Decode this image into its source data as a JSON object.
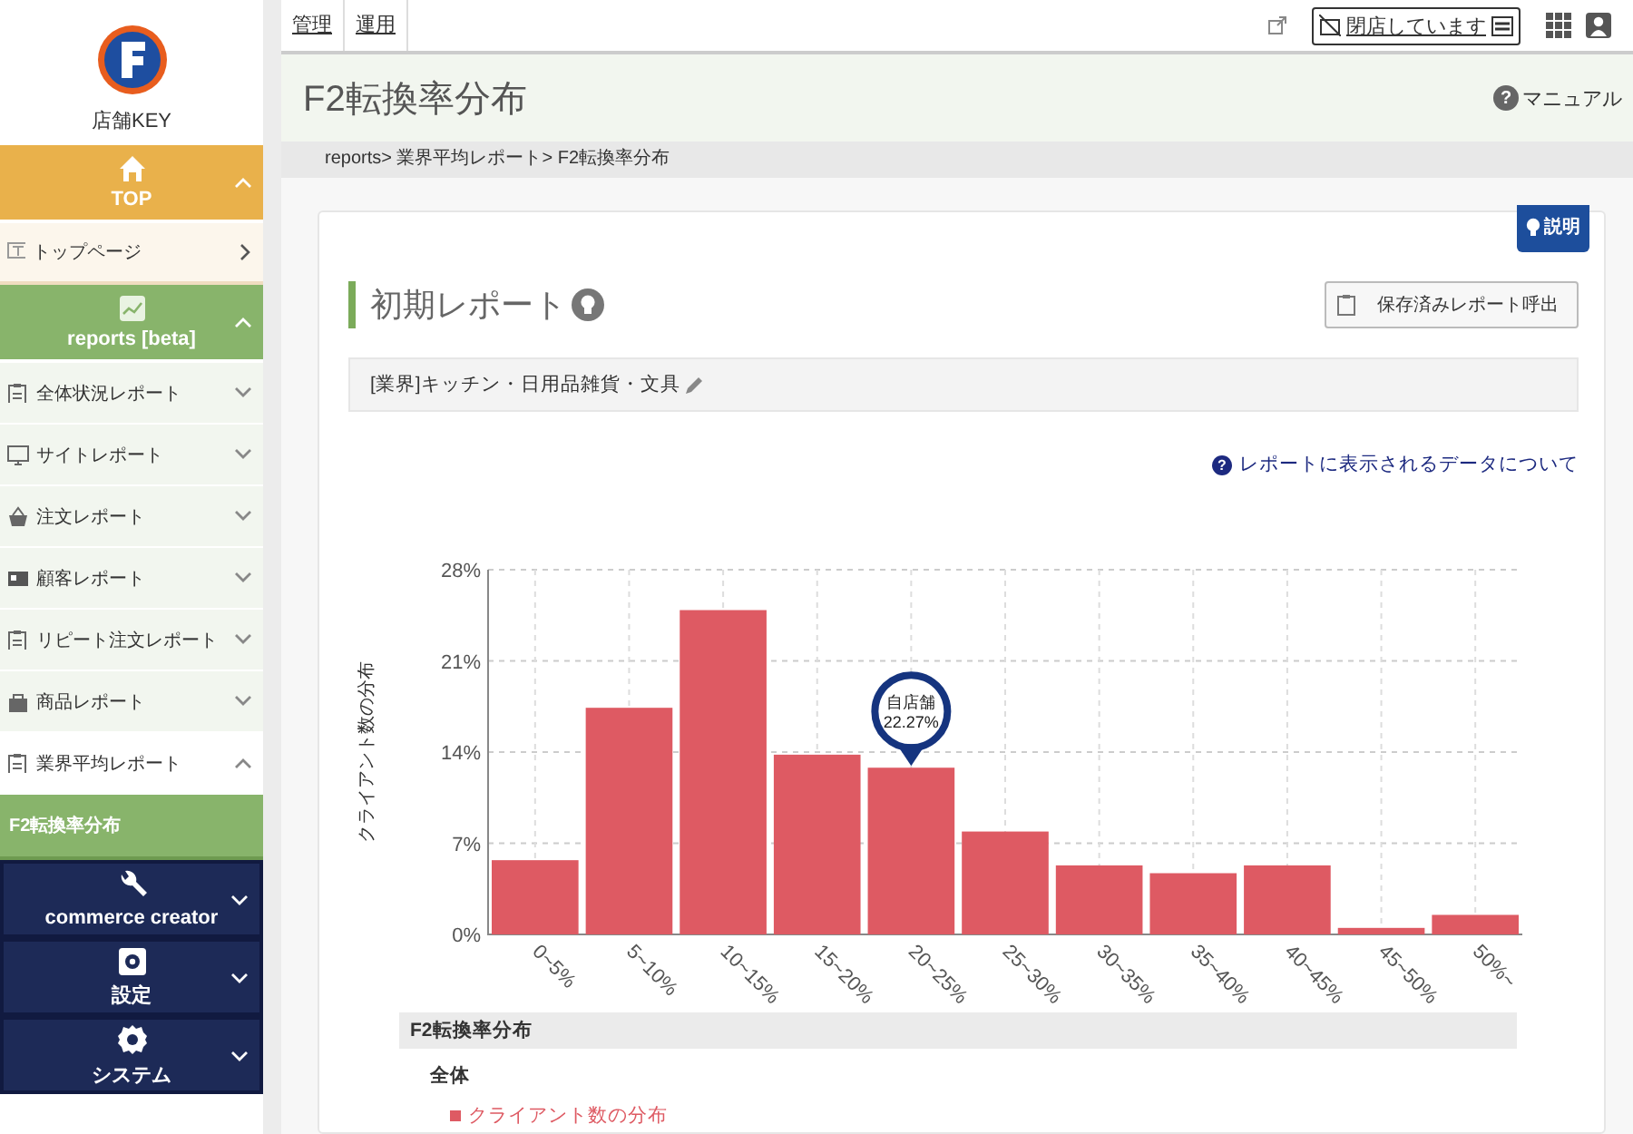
{
  "sidebar": {
    "store_key": "店舗KEY",
    "sections": [
      {
        "label": "TOP",
        "color": "#e9b14b",
        "expanded": true,
        "items": [
          {
            "label": "トップページ",
            "expanded": false,
            "kind": "link"
          }
        ]
      },
      {
        "label": "reports [beta]",
        "color": "#88b46b",
        "expanded": true,
        "items": [
          {
            "label": "全体状況レポート",
            "expanded": false,
            "kind": "group"
          },
          {
            "label": "サイトレポート",
            "expanded": false,
            "kind": "group"
          },
          {
            "label": "注文レポート",
            "expanded": false,
            "kind": "group"
          },
          {
            "label": "顧客レポート",
            "expanded": false,
            "kind": "group"
          },
          {
            "label": "リピート注文レポート",
            "expanded": false,
            "kind": "group"
          },
          {
            "label": "商品レポート",
            "expanded": false,
            "kind": "group"
          },
          {
            "label": "業界平均レポート",
            "expanded": true,
            "kind": "group",
            "children": [
              {
                "label": "F2転換率分布",
                "selected": true
              }
            ]
          }
        ]
      },
      {
        "label": "commerce creator",
        "color": "#1d2a57",
        "expanded": false
      },
      {
        "label": "設定",
        "color": "#1d2a57",
        "expanded": false
      },
      {
        "label": "システム",
        "color": "#1d2a57",
        "expanded": false
      }
    ]
  },
  "topbar": {
    "tabs": [
      {
        "label": "管理",
        "selected": false
      },
      {
        "label": "運用",
        "selected": false
      }
    ],
    "store_status": "閉店しています"
  },
  "page": {
    "title": "F2転換率分布",
    "manual_icon": "?",
    "manual": "マニュアル",
    "breadcrumb": "reports> 業界平均レポート> F2転換率分布"
  },
  "report": {
    "ribbon": "説明",
    "heading": "初期レポート",
    "load_button": "保存済みレポート呼出",
    "filter": "[業界]キッチン・日用品雑貨・文具",
    "data_link_icon": "?",
    "data_link": "レポートに表示されるデータについて",
    "chart_data": {
      "type": "bar",
      "ylabel": "クライアント数の分布",
      "grid": true,
      "categories": [
        "0~5%",
        "5~10%",
        "10~15%",
        "15~20%",
        "20~25%",
        "25~30%",
        "30~35%",
        "35~40%",
        "40~45%",
        "45~50%",
        "50%~"
      ],
      "series": [
        {
          "name": "クライアント数の分布",
          "color": "#de5a63",
          "values": [
            5.7,
            17.4,
            24.9,
            13.8,
            12.8,
            7.9,
            5.3,
            4.7,
            5.3,
            0.5,
            1.5
          ]
        }
      ],
      "ylim": [
        0,
        28
      ],
      "yticks": [
        {
          "value": 0,
          "label": "0%"
        },
        {
          "value": 7,
          "label": "7%"
        },
        {
          "value": 14,
          "label": "14%"
        },
        {
          "value": 21,
          "label": "21%"
        },
        {
          "value": 28,
          "label": "28%"
        }
      ],
      "annotations": [
        "自店舗",
        "22.27%"
      ]
    },
    "table_title": "F2転換率分布",
    "group": "全体"
  }
}
